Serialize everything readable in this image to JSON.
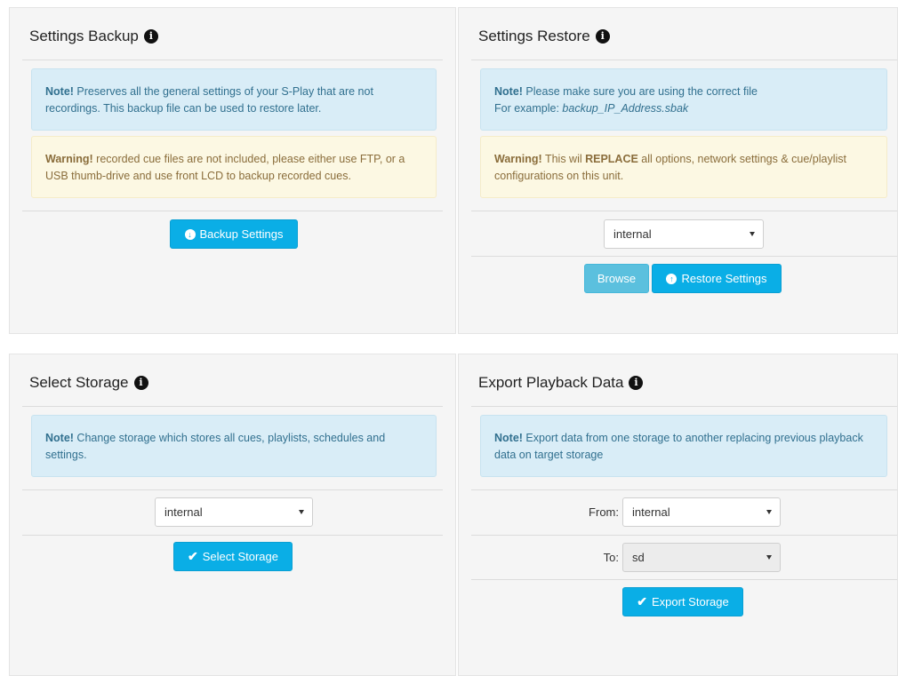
{
  "backup": {
    "title": "Settings Backup",
    "note_label": "Note!",
    "note_text": " Preserves all the general settings of your S-Play that are not recordings. This backup file can be used to restore later.",
    "warning_label": "Warning!",
    "warning_text": " recorded cue files are not included, please either use FTP, or a USB thumb-drive and use front LCD to backup recorded cues.",
    "button_label": "Backup Settings"
  },
  "restore": {
    "title": "Settings Restore",
    "note_label": "Note!",
    "note_text": " Please make sure you are using the correct file",
    "note_example_prefix": "For example: ",
    "note_example_file": "backup_IP_Address.sbak",
    "warning_label": "Warning!",
    "warning_text_1": " This wil ",
    "warning_bold": "REPLACE",
    "warning_text_2": " all options, network settings & cue/playlist configurations on this unit.",
    "storage_selected": "internal",
    "browse_label": "Browse",
    "button_label": "Restore Settings"
  },
  "storage": {
    "title": "Select Storage",
    "note_label": "Note!",
    "note_text": " Change storage which stores all cues, playlists, schedules and settings.",
    "storage_selected": "internal",
    "button_label": "Select Storage"
  },
  "export": {
    "title": "Export Playback Data",
    "note_label": "Note!",
    "note_text": " Export data from one storage to another replacing previous playback data on target storage",
    "from_label": "From:",
    "from_selected": "internal",
    "to_label": "To:",
    "to_selected": "sd",
    "button_label": "Export Storage"
  },
  "icons": {
    "info": "info-circle-icon",
    "download": "arrow-circle-down-icon",
    "upload": "arrow-circle-up-icon",
    "check": "check-icon",
    "caret": "caret-down-icon"
  },
  "colors": {
    "primary_button": "#0aaee6",
    "browse_button": "#5bc0de",
    "info_bg": "#d9edf7",
    "info_text": "#31708f",
    "warning_bg": "#fcf8e3",
    "warning_text": "#8a6d3b",
    "panel_bg": "#f5f5f5"
  }
}
